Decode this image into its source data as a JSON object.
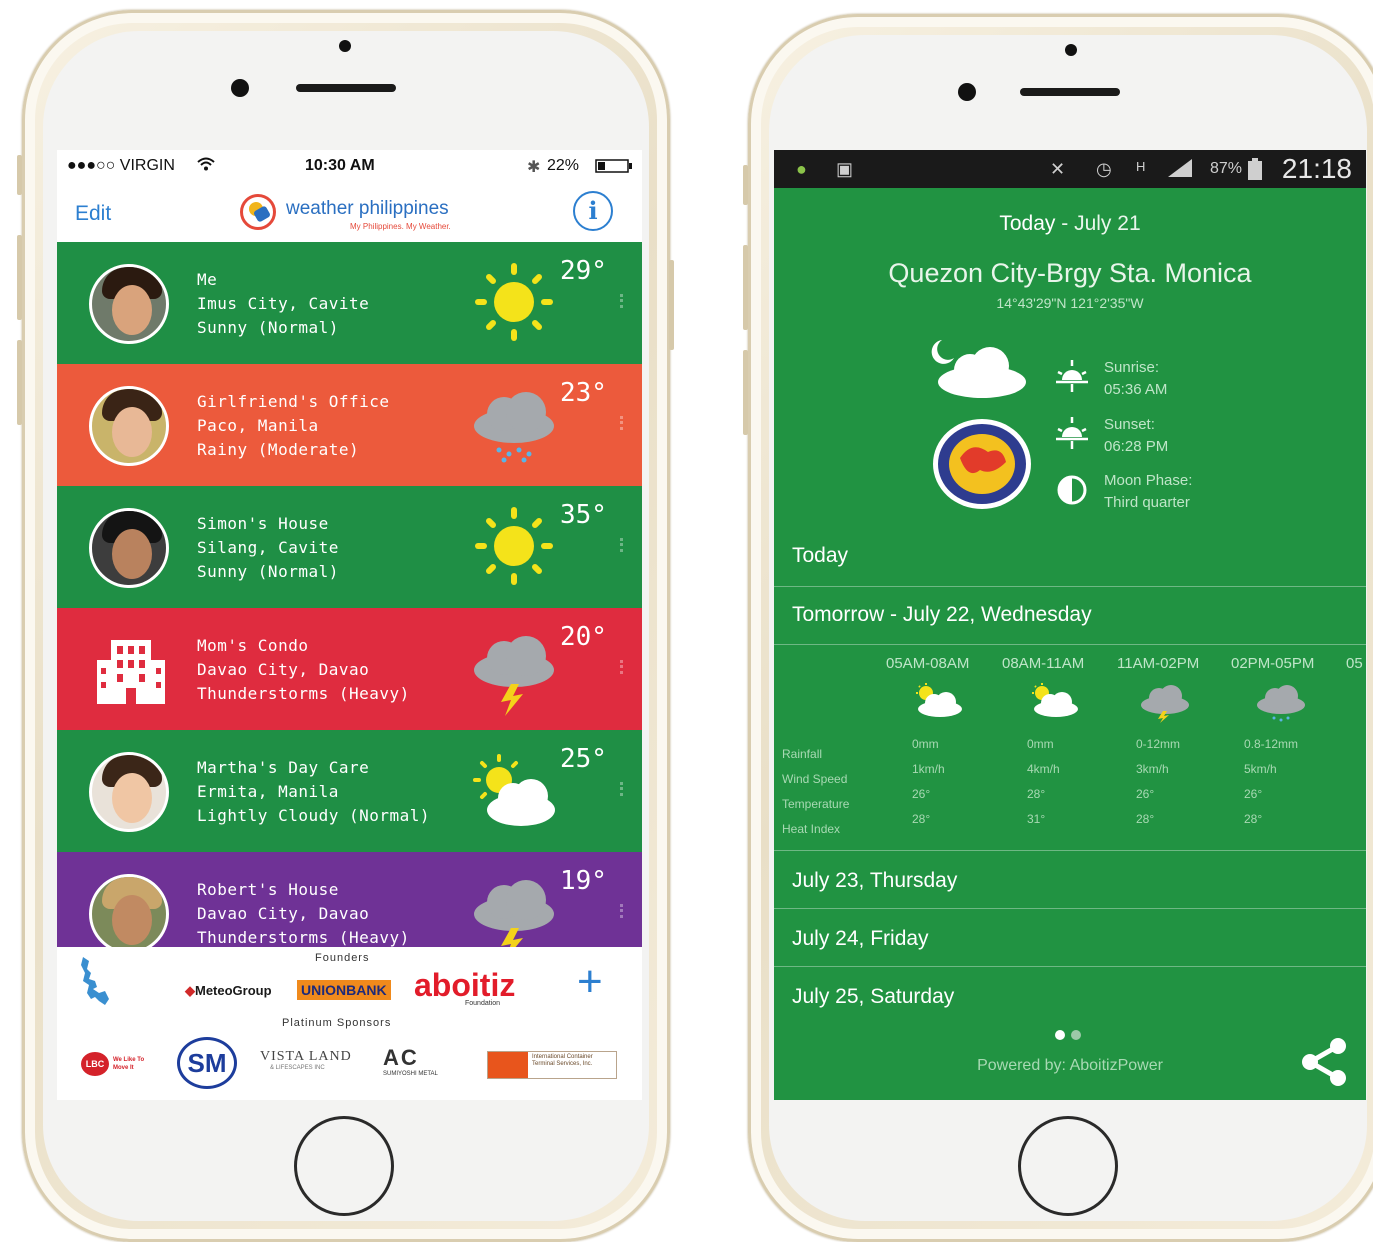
{
  "left_phone": {
    "status": {
      "carrier": "●●●○○ VIRGIN",
      "wifi": "wifi-icon",
      "time": "10:30 AM",
      "bluetooth": "bluetooth-icon",
      "battery": "22%"
    },
    "nav": {
      "edit": "Edit",
      "logo_text": "weather philippines",
      "logo_tagline": "My Philippines. My Weather.",
      "info": "i"
    },
    "locations": [
      {
        "name": "Me",
        "city": "Imus City, Cavite",
        "condition": "Sunny (Normal)",
        "temp": "29°",
        "icon": "sunny-icon",
        "color": "#1f8f45"
      },
      {
        "name": "Girlfriend's Office",
        "city": "Paco, Manila",
        "condition": "Rainy (Moderate)",
        "temp": "23°",
        "icon": "rain-cloud-icon",
        "color": "#ec5a3c"
      },
      {
        "name": "Simon's House",
        "city": "Silang, Cavite",
        "condition": "Sunny (Normal)",
        "temp": "35°",
        "icon": "sunny-icon",
        "color": "#1f8f45"
      },
      {
        "name": "Mom's Condo",
        "city": "Davao City, Davao",
        "condition": "Thunderstorms (Heavy)",
        "temp": "20°",
        "icon": "thunderstorm-icon",
        "color": "#df2c3f"
      },
      {
        "name": "Martha's Day Care",
        "city": "Ermita, Manila",
        "condition": "Lightly Cloudy (Normal)",
        "temp": "25°",
        "icon": "partly-cloudy-icon",
        "color": "#1f8f45"
      },
      {
        "name": "Robert's House",
        "city": "Davao City, Davao",
        "condition": "Thunderstorms (Heavy)",
        "temp": "19°",
        "icon": "thunderstorm-icon",
        "color": "#6f3296"
      }
    ],
    "sponsors": {
      "founders_label": "Founders",
      "founders": [
        "MeteoGroup",
        "UNIONBANK",
        "aboitiz"
      ],
      "aboitiz_sub": "Foundation",
      "platinum_label": "Platinum Sponsors",
      "platinum": [
        "LBC",
        "We Like To Move It",
        "SM",
        "VISTA LAND",
        "& LIFESCAPES INC",
        "AC",
        "SUMIYOSHI METAL",
        "International Container Terminal Services, Inc."
      ],
      "add_label": "+"
    }
  },
  "right_phone": {
    "status": {
      "battery": "87%",
      "time": "21:18"
    },
    "header": {
      "today": "Today",
      "date": " - July 21",
      "city": "Quezon City-Brgy Sta. Monica",
      "coords": "14°43'29\"N 121°2'35\"W"
    },
    "sun": [
      {
        "label": "Sunrise:",
        "value": "05:36 AM"
      },
      {
        "label": "Sunset:",
        "value": "06:28 PM"
      },
      {
        "label": "Moon Phase:",
        "value": "Third quarter"
      }
    ],
    "sections": [
      "Today",
      "Tomorrow - July 22, Wednesday",
      "July 23, Thursday",
      "July 24, Friday",
      "July 25, Saturday"
    ],
    "hourly": {
      "periods": [
        "05AM-08AM",
        "08AM-11AM",
        "11AM-02PM",
        "02PM-05PM",
        "05"
      ],
      "row_labels": [
        "Rainfall",
        "Wind Speed",
        "Temperature",
        "Heat Index"
      ],
      "icons": [
        "partly-cloudy-icon",
        "partly-cloudy-icon",
        "thunderstorm-icon",
        "rain-cloud-icon"
      ],
      "rows": [
        [
          "0mm",
          "0mm",
          "0-12mm",
          "0.8-12mm"
        ],
        [
          "1km/h",
          "4km/h",
          "3km/h",
          "5km/h"
        ],
        [
          "26°",
          "28°",
          "26°",
          "26°"
        ],
        [
          "28°",
          "31°",
          "28°",
          "28°"
        ]
      ]
    },
    "footer": {
      "powered": "Powered by: AboitizPower"
    }
  }
}
